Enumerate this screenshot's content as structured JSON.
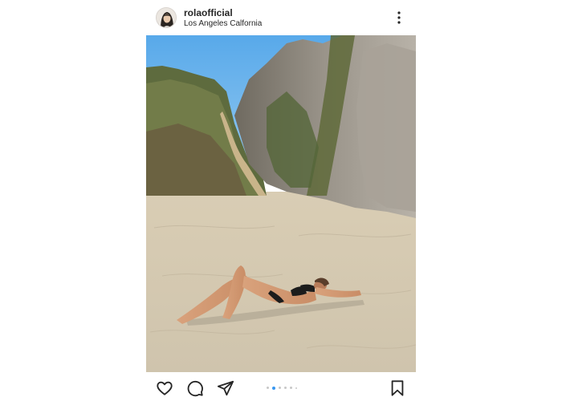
{
  "post": {
    "username": "rolaofficial",
    "location": "Los Angeles Calfornia",
    "photo_alt": "",
    "carousel": {
      "count": 6,
      "active_index": 1
    }
  },
  "icons": {
    "more": "more-options-icon",
    "like": "heart-icon",
    "comment": "comment-icon",
    "share": "send-icon",
    "save": "bookmark-icon"
  },
  "colors": {
    "text": "#262626",
    "carousel_active": "#3897f0",
    "carousel_inactive": "#c7c7c7"
  }
}
